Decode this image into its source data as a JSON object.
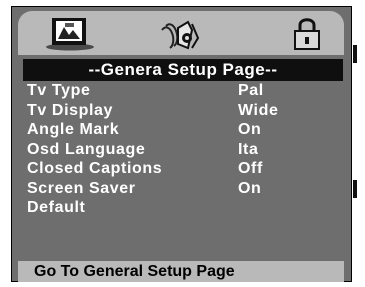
{
  "tabs": [
    {
      "icon": "tv-screen-icon",
      "active": true
    },
    {
      "icon": "speaker-audio-icon",
      "active": false
    },
    {
      "icon": "padlock-icon",
      "active": false
    }
  ],
  "page_title": "--Genera Setup Page--",
  "menu_items": [
    {
      "label": "Tv Type",
      "value": "Pal"
    },
    {
      "label": "Tv Display",
      "value": "Wide"
    },
    {
      "label": "Angle Mark",
      "value": "On"
    },
    {
      "label": "Osd Language",
      "value": "Ita"
    },
    {
      "label": "Closed Captions",
      "value": "Off"
    },
    {
      "label": "Screen Saver",
      "value": "On"
    },
    {
      "label": "Default",
      "value": ""
    }
  ],
  "status_text": "Go To General Setup Page",
  "colors": {
    "panel": "#6e6e6e",
    "tabbar": "#b9b9b9",
    "title_bg": "#0f0f0f",
    "text": "#ffffff"
  }
}
